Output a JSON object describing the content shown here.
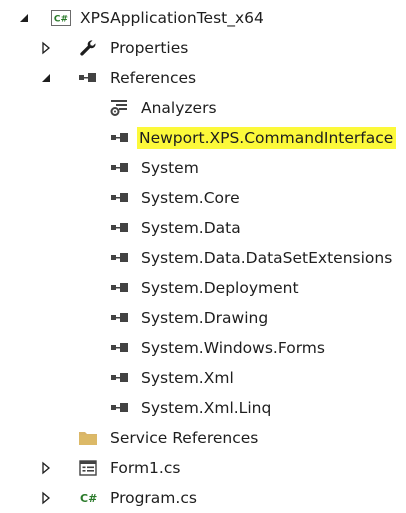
{
  "tree": {
    "project": {
      "label": "XPSApplicationTest_x64",
      "icon": "csharp-project-icon",
      "state": "expanded"
    },
    "properties": {
      "label": "Properties",
      "icon": "wrench-icon",
      "state": "collapsed"
    },
    "references": {
      "label": "References",
      "icon": "references-icon",
      "state": "expanded",
      "items": [
        {
          "label": "Analyzers",
          "icon": "analyzers-icon"
        },
        {
          "label": "Newport.XPS.CommandInterface",
          "icon": "reference-icon",
          "highlighted": true
        },
        {
          "label": "System",
          "icon": "reference-icon"
        },
        {
          "label": "System.Core",
          "icon": "reference-icon"
        },
        {
          "label": "System.Data",
          "icon": "reference-icon"
        },
        {
          "label": "System.Data.DataSetExtensions",
          "icon": "reference-icon"
        },
        {
          "label": "System.Deployment",
          "icon": "reference-icon"
        },
        {
          "label": "System.Drawing",
          "icon": "reference-icon"
        },
        {
          "label": "System.Windows.Forms",
          "icon": "reference-icon"
        },
        {
          "label": "System.Xml",
          "icon": "reference-icon"
        },
        {
          "label": "System.Xml.Linq",
          "icon": "reference-icon"
        }
      ]
    },
    "service_references": {
      "label": "Service References",
      "icon": "folder-icon"
    },
    "form1": {
      "label": "Form1.cs",
      "icon": "form-icon",
      "state": "collapsed"
    },
    "program": {
      "label": "Program.cs",
      "icon": "csharp-file-icon",
      "state": "collapsed"
    },
    "csharp_badge": "C#"
  },
  "colors": {
    "highlight": "#fcf93a",
    "text": "#1e1e1e",
    "csharp_green": "#2a7a2a",
    "folder": "#d9b56a",
    "icon_dark": "#424242"
  }
}
